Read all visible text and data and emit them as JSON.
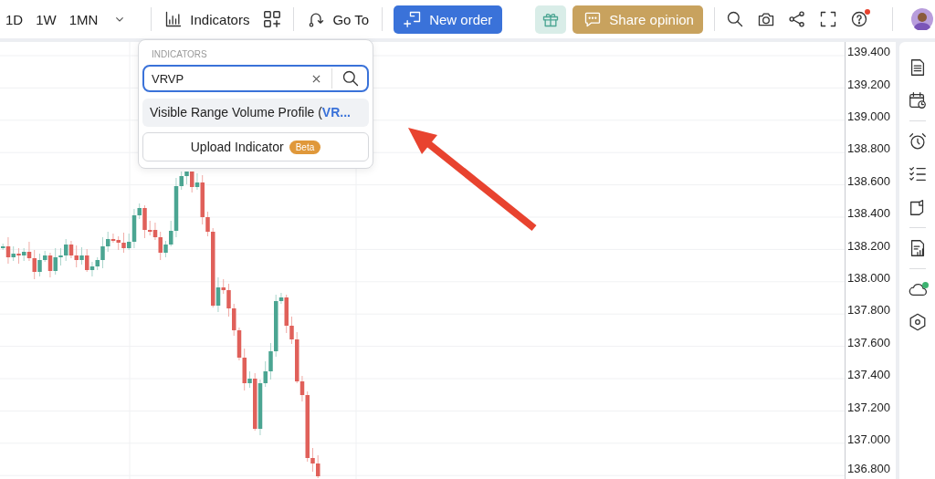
{
  "toolbar": {
    "timeframes": [
      {
        "label": "1D",
        "selected": false
      },
      {
        "label": "1W",
        "selected": false
      },
      {
        "label": "1MN",
        "selected": false
      }
    ],
    "indicators_button": {
      "label": "Indicators"
    },
    "goto_button": {
      "label": "Go To"
    },
    "new_order_button": {
      "label": "New order"
    },
    "share_opinion_button": {
      "label": "Share opinion"
    },
    "tools": [
      {
        "kind": "search",
        "notification": false
      },
      {
        "kind": "camera",
        "notification": false
      },
      {
        "kind": "share",
        "notification": false
      },
      {
        "kind": "fullscreen",
        "notification": false
      },
      {
        "kind": "help",
        "notification": true
      }
    ]
  },
  "indicators_popup": {
    "heading": "INDICATORS",
    "search": {
      "value": "VRVP",
      "focused": true
    },
    "results": [
      {
        "label": "Visible Range Volume Profile (**VR...**",
        "selected": true
      }
    ],
    "upload_button": {
      "label": "Upload Indicator",
      "badge": "Beta"
    }
  },
  "price_axis": {
    "labels": [
      "139.400",
      "139.200",
      "139.000",
      "138.800",
      "138.600",
      "138.400",
      "138.200",
      "138.000",
      "137.800",
      "137.600",
      "137.400",
      "137.200",
      "137.000",
      "136.800"
    ]
  },
  "sidebar": {
    "groups": [
      [
        {
          "kind": "document"
        },
        {
          "kind": "calendar"
        }
      ],
      [
        {
          "kind": "alarm"
        },
        {
          "kind": "checklist"
        },
        {
          "kind": "note"
        }
      ],
      [
        {
          "kind": "report"
        }
      ],
      [
        {
          "kind": "cloud",
          "status": true
        },
        {
          "kind": "hexagon"
        }
      ]
    ]
  }
}
